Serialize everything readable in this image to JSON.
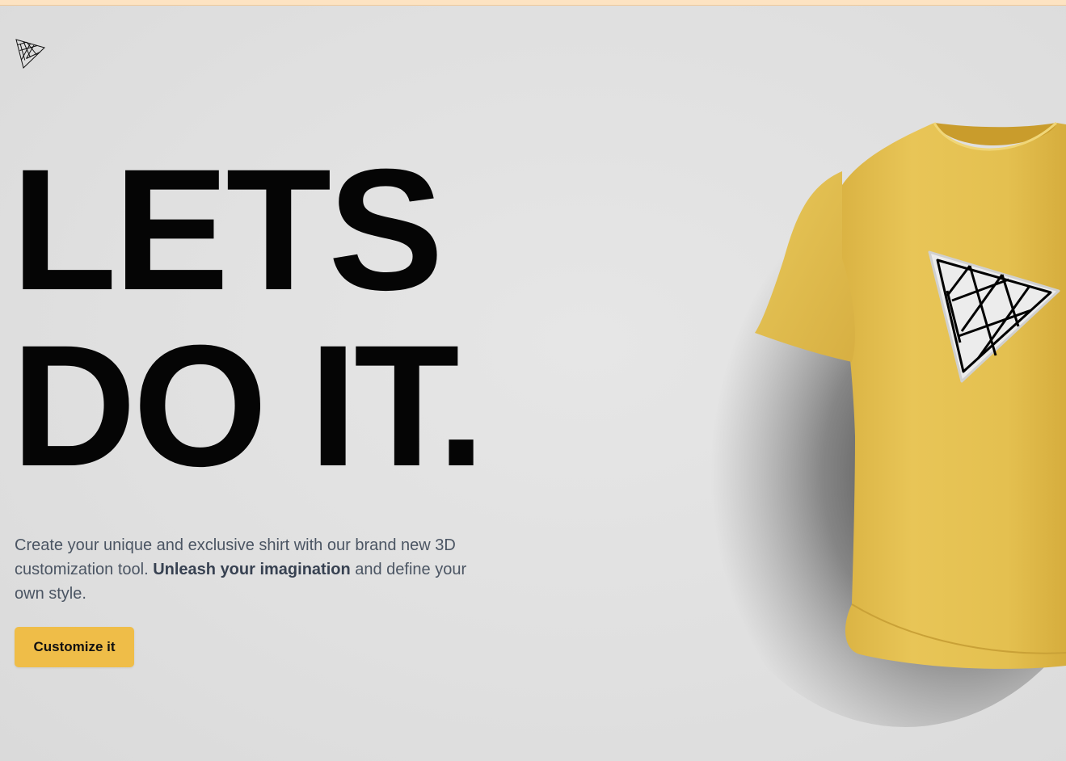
{
  "header": {
    "logo_icon": "threejs-triangle-logo-icon"
  },
  "hero": {
    "headline_line1": "LETS",
    "headline_line2": "DO IT.",
    "description_prefix": "Create your unique and exclusive shirt with our brand new 3D customization tool. ",
    "description_bold": "Unleash your imagination",
    "description_suffix": " and define your own style.",
    "cta_label": "Customize it"
  },
  "shirt": {
    "color": "#e6c250",
    "decal_icon": "threejs-triangle-logo-icon"
  },
  "colors": {
    "background": "#e0e0e0",
    "accent": "#efbd48",
    "text_dark": "#050505",
    "text_muted": "#4b5563"
  }
}
